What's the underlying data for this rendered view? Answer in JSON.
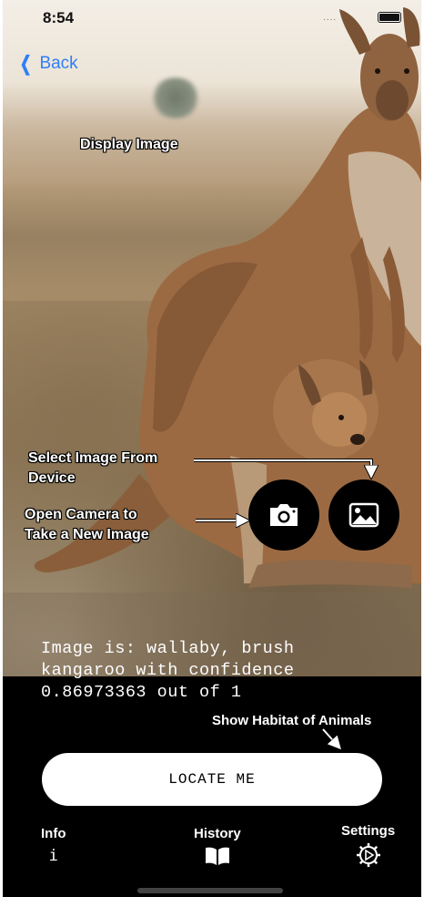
{
  "status_bar": {
    "time": "8:54",
    "signal": "...."
  },
  "nav": {
    "back_label": "Back"
  },
  "annotations": {
    "display_image": "Display Image",
    "select_image": "Select Image From Device",
    "open_camera": "Open Camera to Take a New Image",
    "show_habitat": "Show Habitat of Animals"
  },
  "result": {
    "text": "Image is: wallaby, brush kangaroo with confidence 0.86973363 out of 1"
  },
  "locate_button": {
    "label": "LOCATE ME"
  },
  "tabs": [
    {
      "label": "Info",
      "icon": "info-icon",
      "glyph": "i"
    },
    {
      "label": "History",
      "icon": "book-icon"
    },
    {
      "label": "Settings",
      "icon": "gear-icon"
    }
  ],
  "colors": {
    "accent": "#2f7ff6",
    "background": "#000000",
    "button": "#ffffff"
  }
}
